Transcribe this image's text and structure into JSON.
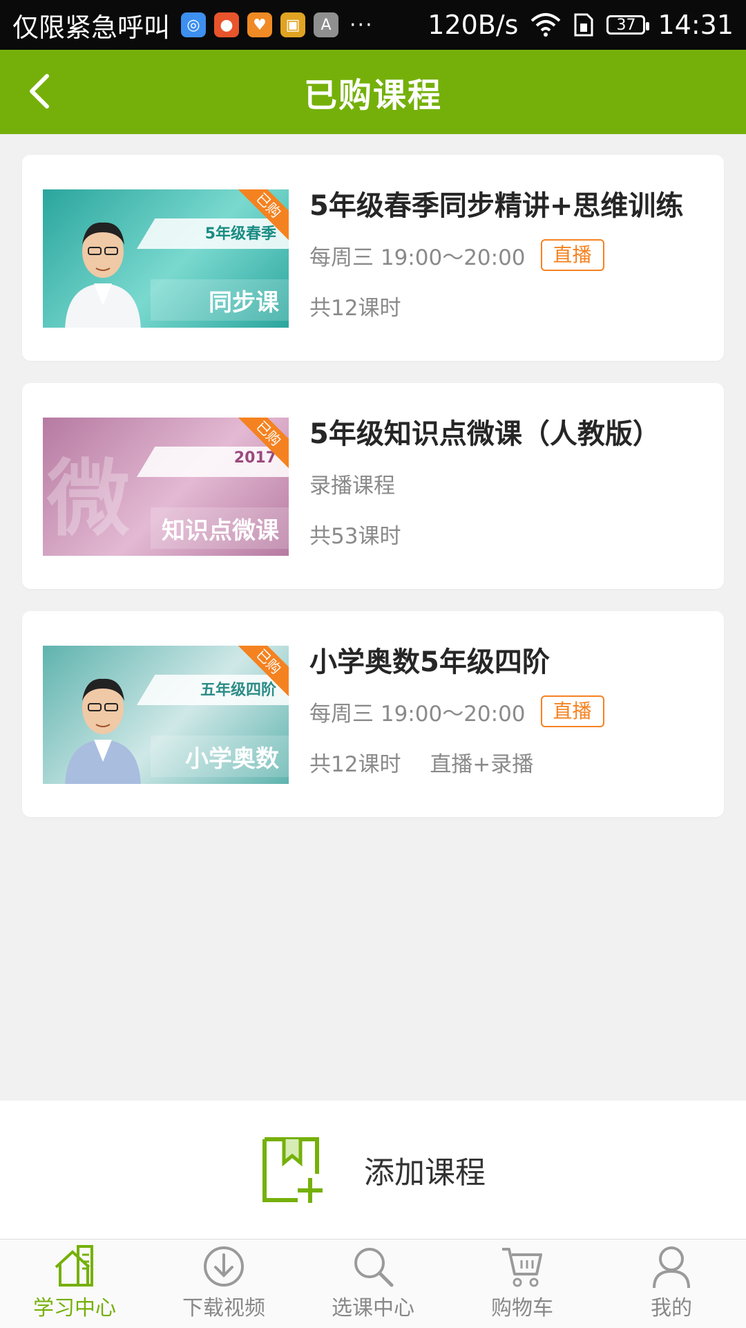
{
  "status_bar": {
    "carrier_text": "仅限紧急呼叫",
    "more": "···",
    "speed": "120B/s",
    "battery": "37",
    "time": "14:31",
    "app_icons": [
      {
        "name": "browser-app-icon",
        "color": "#3d8ff0",
        "glyph": "◎"
      },
      {
        "name": "game-center-app-icon",
        "color": "#e8542b",
        "glyph": "●"
      },
      {
        "name": "health-app-icon",
        "color": "#f08a24",
        "glyph": "♥"
      },
      {
        "name": "bag-app-icon",
        "color": "#e0a322",
        "glyph": "▣"
      },
      {
        "name": "keyboard-app-icon",
        "color": "#8f8f8f",
        "glyph": "A"
      }
    ]
  },
  "header": {
    "title": "已购课程"
  },
  "courses": [
    {
      "title": "5年级春季同步精讲+思维训练",
      "schedule": "每周三 19:00～20:00",
      "badge": "直播",
      "lessons": "共12课时",
      "extra": "",
      "thumb": {
        "tag": "5年级春季",
        "big": "同步课",
        "corner": "已购",
        "bg1": "#2aa59d",
        "bg2": "#7ad9cf",
        "tag_color": "#1a8c83"
      }
    },
    {
      "title": "5年级知识点微课（人教版）",
      "schedule": "录播课程",
      "badge": "",
      "lessons": "共53课时",
      "extra": "",
      "thumb": {
        "tag": "2017",
        "big": "知识点微课",
        "corner": "已购",
        "bg1": "#b67aa1",
        "bg2": "#e3b9d3",
        "tag_color": "#9a4a7c",
        "watermark": "微"
      }
    },
    {
      "title": "小学奥数5年级四阶",
      "schedule": "每周三 19:00～20:00",
      "badge": "直播",
      "lessons": "共12课时",
      "extra": "直播+录播",
      "thumb": {
        "tag": "五年级四阶",
        "big": "小学奥数",
        "corner": "已购",
        "bg1": "#5fb3ae",
        "bg2": "#cfe8e7",
        "tag_color": "#2c8c87"
      }
    }
  ],
  "add_course": {
    "label": "添加课程"
  },
  "bottom_nav": [
    {
      "label": "学习中心",
      "icon": "home-icon",
      "active": true
    },
    {
      "label": "下载视频",
      "icon": "download-icon",
      "active": false
    },
    {
      "label": "选课中心",
      "icon": "search-icon",
      "active": false
    },
    {
      "label": "购物车",
      "icon": "cart-icon",
      "active": false
    },
    {
      "label": "我的",
      "icon": "user-icon",
      "active": false
    }
  ],
  "colors": {
    "brand_green": "#75b00a",
    "accent_orange": "#f58220"
  }
}
